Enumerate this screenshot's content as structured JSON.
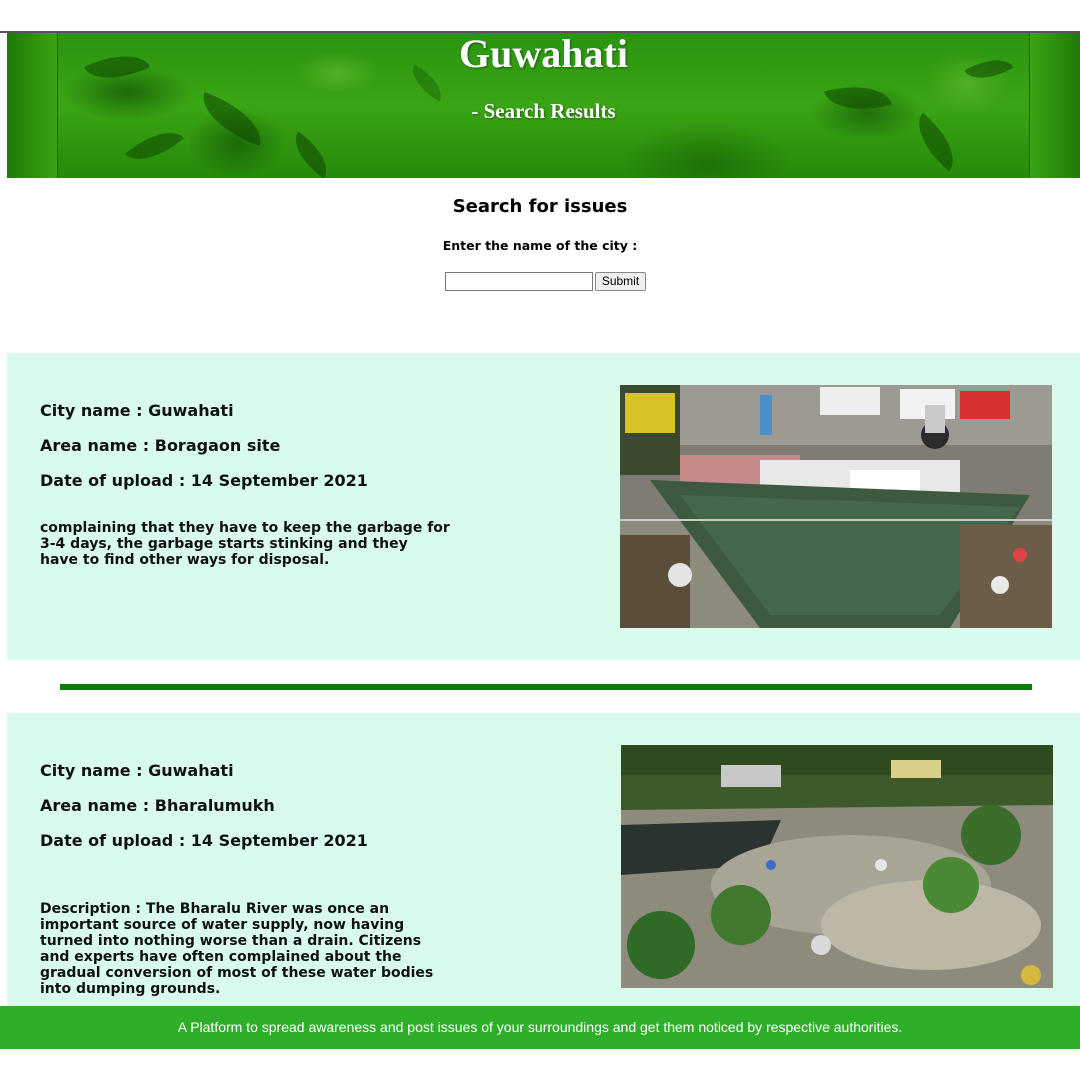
{
  "header": {
    "title": "Guwahati",
    "subtitle": "- Search Results"
  },
  "search": {
    "title": "Search for issues",
    "label": "Enter the name of the city :",
    "input_value": "",
    "submit_label": "Submit"
  },
  "results": [
    {
      "city": "City name : Guwahati",
      "area": "Area name : Boragaon site",
      "date": "Date of upload : 14 September 2021",
      "description": "complaining that they have to keep the garbage for 3-4 days, the garbage starts stinking and they have to find other ways for disposal.",
      "image": "garbage-dumpster-photo"
    },
    {
      "city": "City name : Guwahati",
      "area": "Area name : Bharalumukh",
      "date": "Date of upload : 14 September 2021",
      "description": "Description : The Bharalu River was once an important source of water supply, now having turned into nothing worse than a drain. Citizens and experts have often complained about the gradual conversion of most of these water bodies into dumping grounds.",
      "image": "polluted-river-photo"
    }
  ],
  "footer": {
    "text": "A Platform to spread awareness and post issues of your surroundings and get them noticed by respective authorities."
  },
  "colors": {
    "banner_green": "#3aa514",
    "card_bg": "#d8fbee",
    "divider": "#0a7d0a",
    "footer_bg": "#2eaf2a"
  }
}
